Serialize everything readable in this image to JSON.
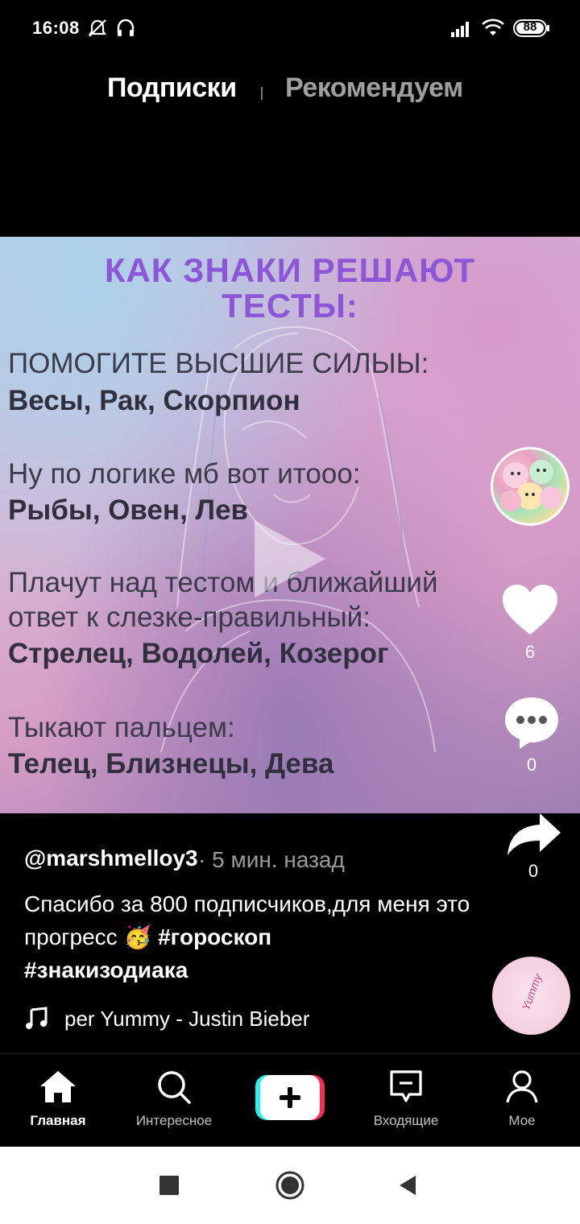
{
  "status_bar": {
    "time": "16:08",
    "battery": "88",
    "icons": [
      "alarm-off-icon",
      "headphones-icon",
      "signal-icon",
      "wifi-icon",
      "battery-icon"
    ]
  },
  "top_tabs": {
    "following": "Подписки",
    "for_you": "Рекомендуем"
  },
  "video": {
    "title_line1": "КАК  ЗНАКИ  РЕШАЮТ",
    "title_line2": "ТЕСТЫ:",
    "lines": [
      {
        "text": "ПОМОГИТЕ ВЫСШИЕ СИЛЫЫ:",
        "bold": false
      },
      {
        "text": "Весы, Рак, Скорпион",
        "bold": true
      },
      {
        "text": "Ну по логике мб вот итооо:",
        "bold": false
      },
      {
        "text": "Рыбы, Овен, Лев",
        "bold": true
      },
      {
        "text": "Плачут над тестом и ближайший",
        "bold": false
      },
      {
        "text": "ответ к слезке-правильный:",
        "bold": false
      },
      {
        "text": "Стрелец, Водолей, Козерог",
        "bold": true
      },
      {
        "text": "Тыкают пальцем:",
        "bold": false
      },
      {
        "text": "Телец, Близнецы, Дева",
        "bold": true
      }
    ]
  },
  "rail": {
    "likes": "6",
    "comments": "0",
    "shares": "0"
  },
  "post": {
    "username": "@marshmelloy3",
    "time": "· 5 мин. назад",
    "caption": "Спасибо за 800 подписчиков,для меня это прогресс 🥳",
    "hashtag1": "#гороскоп",
    "hashtag2": "#знакизодиака",
    "music": "per    Yummy - Justin Bieber",
    "disc_label": "Yummy"
  },
  "bottom_nav": {
    "home": "Главная",
    "discover": "Интересное",
    "inbox": "Входящие",
    "profile": "Мое"
  },
  "colors": {
    "title_purple": "#8d55d7",
    "plus_cyan": "#25f4ee",
    "plus_red": "#fe2c55"
  }
}
